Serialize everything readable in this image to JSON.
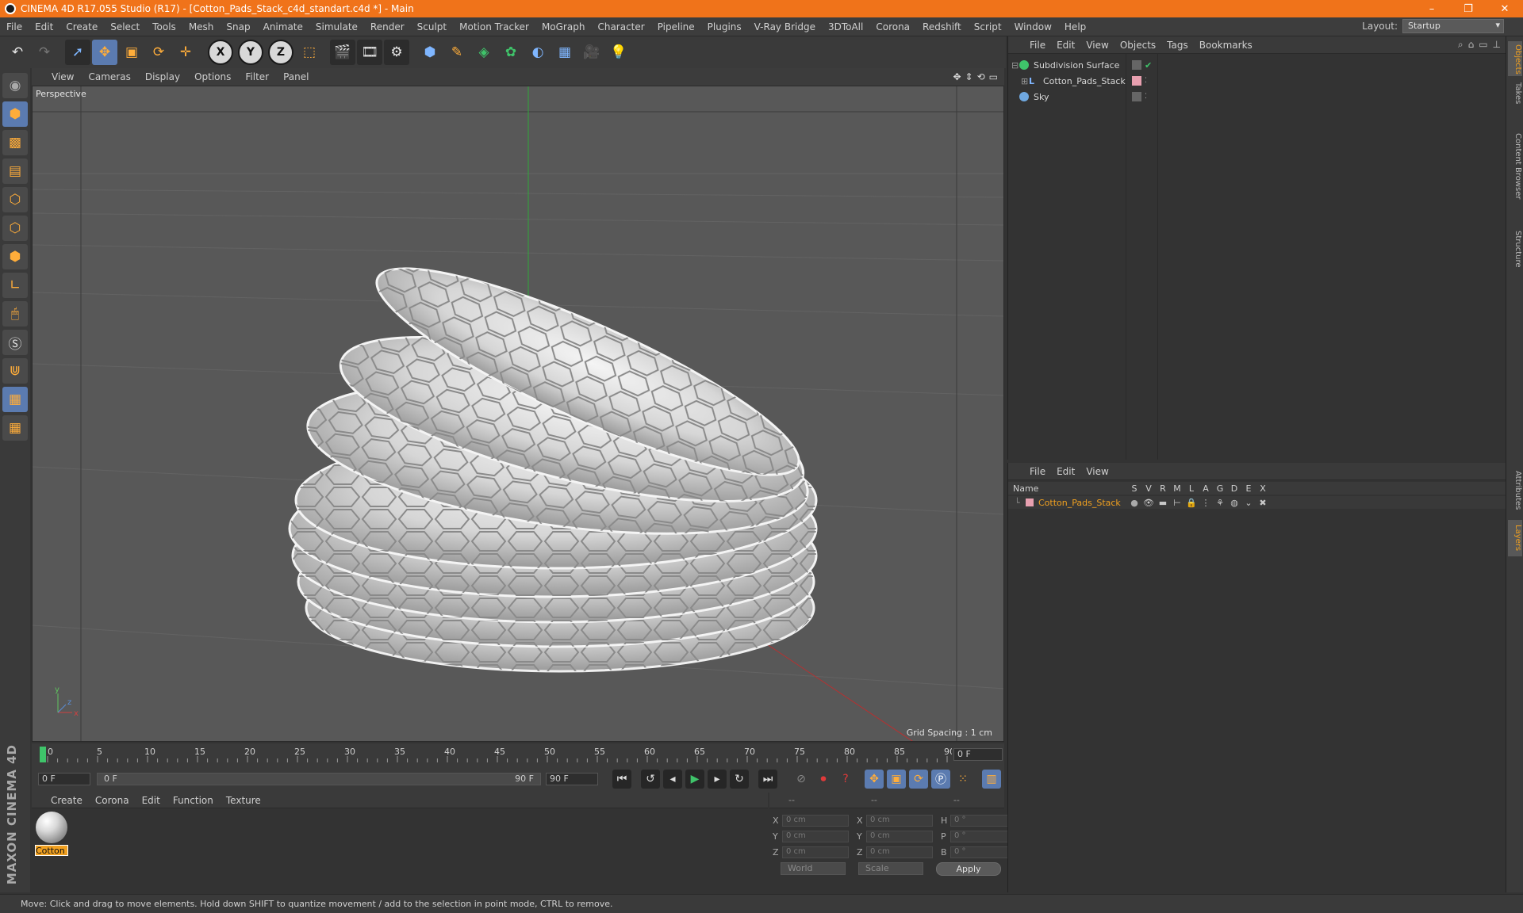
{
  "window": {
    "title": "CINEMA 4D R17.055 Studio (R17) - [Cotton_Pads_Stack_c4d_standart.c4d *] - Main",
    "minimize": "–",
    "maximize": "❐",
    "close": "✕"
  },
  "menu": {
    "items": [
      "File",
      "Edit",
      "Create",
      "Select",
      "Tools",
      "Mesh",
      "Snap",
      "Animate",
      "Simulate",
      "Render",
      "Sculpt",
      "Motion Tracker",
      "MoGraph",
      "Character",
      "Pipeline",
      "Plugins",
      "V-Ray Bridge",
      "3DToAll",
      "Corona",
      "Redshift",
      "Script",
      "Window",
      "Help"
    ],
    "layout_label": "Layout:",
    "layout_value": "Startup"
  },
  "toolbar": {
    "axis_x": "X",
    "axis_y": "Y",
    "axis_z": "Z"
  },
  "viewport": {
    "menu": [
      "View",
      "Cameras",
      "Display",
      "Options",
      "Filter",
      "Panel"
    ],
    "camera_label": "Perspective",
    "grid_spacing": "Grid Spacing : 1 cm",
    "axis_y": "y",
    "axis_z": "z",
    "axis_x": "x"
  },
  "timeline": {
    "ticks": [
      "0",
      "5",
      "10",
      "15",
      "20",
      "25",
      "30",
      "35",
      "40",
      "45",
      "50",
      "55",
      "60",
      "65",
      "70",
      "75",
      "80",
      "85",
      "90"
    ],
    "current_frame": "0 F",
    "start_field": "0 F",
    "range_start": "0 F",
    "range_end": "90 F",
    "end_field": "90 F"
  },
  "materials": {
    "menu": [
      "Create",
      "Corona",
      "Edit",
      "Function",
      "Texture"
    ],
    "items": [
      {
        "name": "Cotton_"
      }
    ]
  },
  "coordinates": {
    "headers": [
      "--",
      "--",
      "--"
    ],
    "rows": [
      {
        "l1": "X",
        "v1": "0 cm",
        "l2": "X",
        "v2": "0 cm",
        "l3": "H",
        "v3": "0 °"
      },
      {
        "l1": "Y",
        "v1": "0 cm",
        "l2": "Y",
        "v2": "0 cm",
        "l3": "P",
        "v3": "0 °"
      },
      {
        "l1": "Z",
        "v1": "0 cm",
        "l2": "Z",
        "v2": "0 cm",
        "l3": "B",
        "v3": "0 °"
      }
    ],
    "space": "World",
    "mode": "Scale",
    "apply": "Apply"
  },
  "objects_panel": {
    "menu": [
      "File",
      "Edit",
      "View",
      "Objects",
      "Tags",
      "Bookmarks"
    ],
    "items": [
      {
        "name": "Subdivision Surface",
        "color": "#3fc46a"
      },
      {
        "name": "Cotton_Pads_Stack",
        "color": "#7fb6ff"
      },
      {
        "name": "Sky",
        "color": "#6fa8e0"
      }
    ]
  },
  "layers_panel": {
    "menu": [
      "File",
      "Edit",
      "View"
    ],
    "columns": [
      "Name",
      "S",
      "V",
      "R",
      "M",
      "L",
      "A",
      "G",
      "D",
      "E",
      "X"
    ],
    "rows": [
      {
        "name": "Cotton_Pads_Stack"
      }
    ]
  },
  "side_tabs": [
    "Objects",
    "Takes",
    "Content Browser",
    "Structure",
    "Attributes",
    "Layers"
  ],
  "status": "Move: Click and drag to move elements. Hold down SHIFT to quantize movement / add to the selection in point mode, CTRL to remove.",
  "brand": "MAXON CINEMA 4D",
  "colors": {
    "accent": "#f0731a",
    "selected_text": "#f0a020"
  }
}
